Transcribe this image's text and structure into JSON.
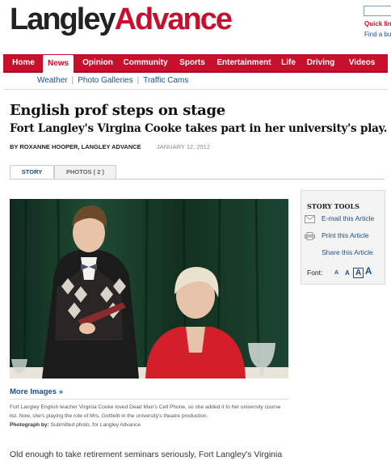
{
  "masthead": {
    "logo_part1": "Langley",
    "logo_part2": "Advance",
    "quick_links": "Quick lin",
    "find_link": "Find a bu"
  },
  "nav": {
    "items": [
      {
        "label": "Home",
        "active": false
      },
      {
        "label": "News",
        "active": true
      },
      {
        "label": "Opinion",
        "active": false
      },
      {
        "label": "Community",
        "active": false
      },
      {
        "label": "Sports",
        "active": false
      },
      {
        "label": "Entertainment",
        "active": false
      },
      {
        "label": "Life",
        "active": false
      },
      {
        "label": "Driving",
        "active": false
      },
      {
        "label": "Videos",
        "active": false
      }
    ]
  },
  "subnav": {
    "items": [
      "Weather",
      "Photo Galleries",
      "Traffic Cams"
    ],
    "separator": "|"
  },
  "article": {
    "headline": "English prof steps on stage",
    "subhead": "Fort Langley's Virgina Cooke takes part in her university's play.",
    "byline": "BY ROXANNE HOOPER, LANGLEY ADVANCE",
    "date": "JANUARY 12, 2012",
    "tabs": [
      "STORY",
      "PHOTOS ( 2 )"
    ],
    "more_images": "More Images »",
    "caption": "Fort Langley English teacher Virginia Cooke loved Dead Man's Cell Phone, so she added it to her university course list. Now, she's playing the role of Mrs. Gottleib in the university's theatre production.",
    "credit_label": "Photograph by:",
    "credit_value": "Submitted photo, for Langley Advance",
    "body_start": "Old enough to take retirement seminars seriously, Fort Langley's Virginia"
  },
  "story_tools": {
    "title": "STORY TOOLS",
    "email": "E-mail this Article",
    "print": "Print this Article",
    "share": "Share this Article",
    "font_label": "Font:",
    "font_sizes": [
      "A",
      "A",
      "A",
      "A"
    ]
  },
  "colors": {
    "brand_red": "#c8102e",
    "link_blue": "#1a4f8b"
  }
}
